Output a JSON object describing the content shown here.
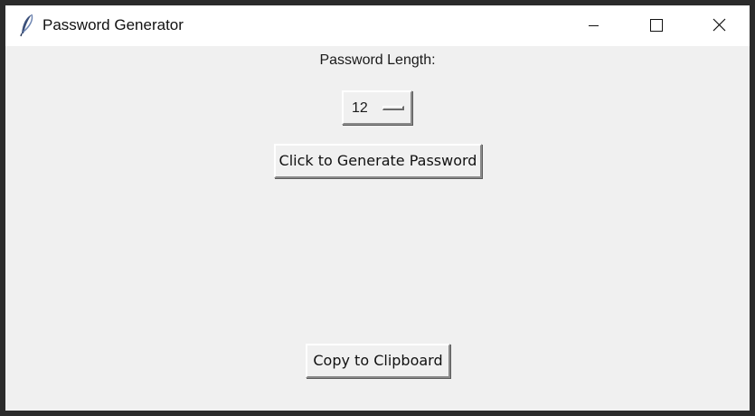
{
  "window": {
    "title": "Password Generator",
    "icon": "feather-icon",
    "controls": {
      "minimize_icon": "minimize-icon",
      "maximize_icon": "maximize-icon",
      "close_icon": "close-icon"
    }
  },
  "form": {
    "length_label": "Password Length:",
    "length_value": "12",
    "generate_label": "Click to Generate Password",
    "copy_label": "Copy to Clipboard"
  }
}
